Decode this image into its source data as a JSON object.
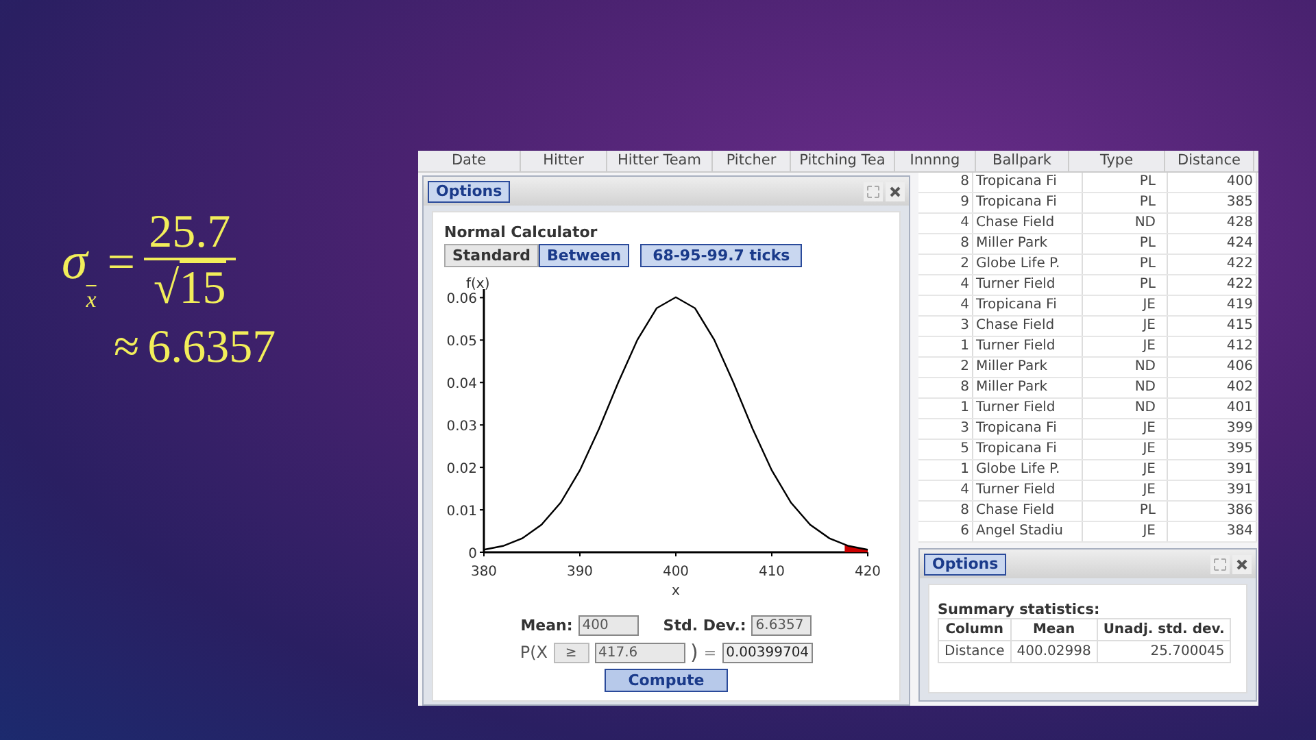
{
  "formula": {
    "symbol": "σ",
    "subscript": "x",
    "equals": "=",
    "numerator": "25.7",
    "radical": "√",
    "radicand": "15",
    "approx": "≈",
    "result": "6.6357"
  },
  "data_table": {
    "columns": [
      "Date",
      "Hitter",
      "Hitter Team",
      "Pitcher",
      "Pitching Tea",
      "Innnng",
      "Ballpark",
      "Type",
      "Distance"
    ],
    "rows": [
      [
        "8",
        "Tropicana Fi",
        "PL",
        "400"
      ],
      [
        "9",
        "Tropicana Fi",
        "PL",
        "385"
      ],
      [
        "4",
        "Chase Field",
        "ND",
        "428"
      ],
      [
        "8",
        "Miller Park",
        "PL",
        "424"
      ],
      [
        "2",
        "Globe Life P.",
        "PL",
        "422"
      ],
      [
        "4",
        "Turner Field",
        "PL",
        "422"
      ],
      [
        "4",
        "Tropicana Fi",
        "JE",
        "419"
      ],
      [
        "3",
        "Chase Field",
        "JE",
        "415"
      ],
      [
        "1",
        "Turner Field",
        "JE",
        "412"
      ],
      [
        "2",
        "Miller Park",
        "ND",
        "406"
      ],
      [
        "8",
        "Miller Park",
        "ND",
        "402"
      ],
      [
        "1",
        "Turner Field",
        "ND",
        "401"
      ],
      [
        "3",
        "Tropicana Fi",
        "JE",
        "399"
      ],
      [
        "5",
        "Tropicana Fi",
        "JE",
        "395"
      ],
      [
        "1",
        "Globe Life P.",
        "JE",
        "391"
      ],
      [
        "4",
        "Turner Field",
        "JE",
        "391"
      ],
      [
        "8",
        "Chase Field",
        "PL",
        "386"
      ],
      [
        "6",
        "Angel Stadiu",
        "JE",
        "384"
      ]
    ]
  },
  "calculator_window": {
    "options_button": "Options",
    "title": "Normal Calculator",
    "tabs": [
      {
        "label": "Standard",
        "selected": false
      },
      {
        "label": "Between",
        "selected": true
      }
    ],
    "ticks_button": {
      "label": "68-95-99.7 ticks",
      "on": true
    },
    "chart_data": {
      "type": "line",
      "xlabel": "x",
      "ylabel": "f(x)",
      "x": [
        380,
        382,
        384,
        386,
        388,
        390,
        392,
        394,
        396,
        398,
        400,
        402,
        404,
        406,
        408,
        410,
        412,
        414,
        416,
        418,
        420
      ],
      "series": [
        {
          "color": "#000000",
          "values": [
            0.0006,
            0.0015,
            0.0033,
            0.0065,
            0.0117,
            0.0193,
            0.0291,
            0.04,
            0.0501,
            0.0575,
            0.0601,
            0.0575,
            0.0501,
            0.04,
            0.0291,
            0.0193,
            0.0117,
            0.0065,
            0.0033,
            0.0015,
            0.0006
          ]
        }
      ],
      "xlim": [
        380,
        420
      ],
      "ylim": [
        0,
        0.062
      ],
      "xticks": [
        380,
        390,
        400,
        410,
        420
      ],
      "yticks": [
        {
          "value": 0,
          "label": "0"
        },
        {
          "value": 0.01,
          "label": "0.01"
        },
        {
          "value": 0.02,
          "label": "0.02"
        },
        {
          "value": 0.03,
          "label": "0.03"
        },
        {
          "value": 0.04,
          "label": "0.04"
        },
        {
          "value": 0.05,
          "label": "0.05"
        },
        {
          "value": 0.06,
          "label": "0.06"
        }
      ]
    },
    "mean_label": "Mean:",
    "mean_value": "400",
    "sd_label": "Std. Dev.:",
    "sd_value": "6.6357",
    "prob_prefix": "P(",
    "prob_variable": "X",
    "operator": "≥",
    "bound": "417.6",
    "prob_close": ")",
    "prob_equals": "=",
    "result": "0.00399704",
    "compute_button": "Compute"
  },
  "summary_window": {
    "options_button": "Options",
    "title": "Summary statistics:",
    "columns": [
      "Column",
      "Mean",
      "Unadj. std. dev."
    ],
    "rows": [
      [
        "Distance",
        "400.02998",
        "25.700045"
      ]
    ]
  }
}
